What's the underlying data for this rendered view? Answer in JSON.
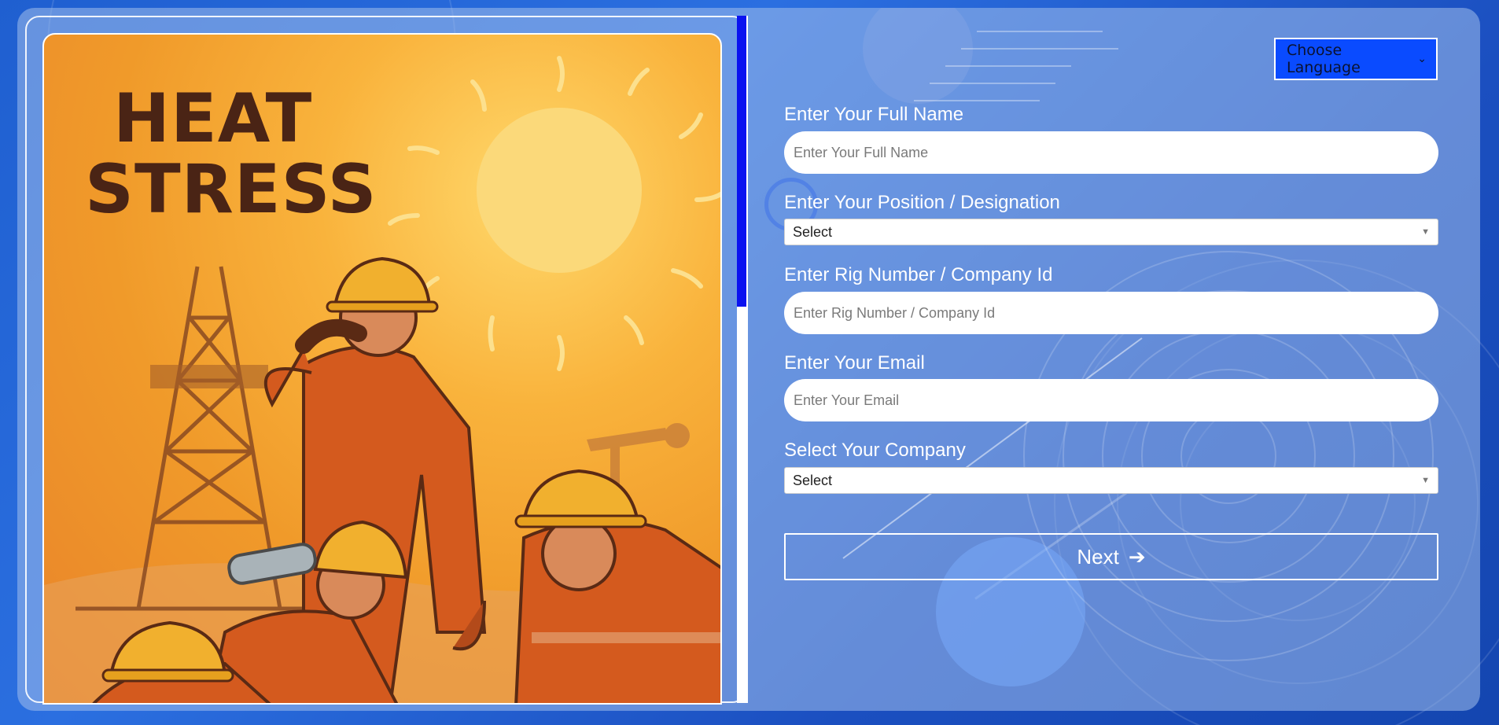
{
  "poster": {
    "title_line1": "HEAT",
    "title_line2": "STRESS"
  },
  "language": {
    "label": "Choose Language",
    "icon": "chevron-down-icon"
  },
  "form": {
    "full_name": {
      "label": "Enter Your Full Name",
      "placeholder": "Enter Your Full Name"
    },
    "position": {
      "label": "Enter Your Position / Designation",
      "selected": "Select"
    },
    "rig_number": {
      "label": "Enter Rig Number / Company Id",
      "placeholder": "Enter Rig Number / Company Id"
    },
    "email": {
      "label": "Enter Your Email",
      "placeholder": "Enter Your Email"
    },
    "company": {
      "label": "Select Your Company",
      "selected": "Select"
    },
    "next_button": {
      "label": "Next",
      "arrow": "➔"
    }
  },
  "colors": {
    "scroll_thumb": "#0a12f0",
    "language_button": "#0a4bff",
    "poster_title": "#4a2415"
  }
}
